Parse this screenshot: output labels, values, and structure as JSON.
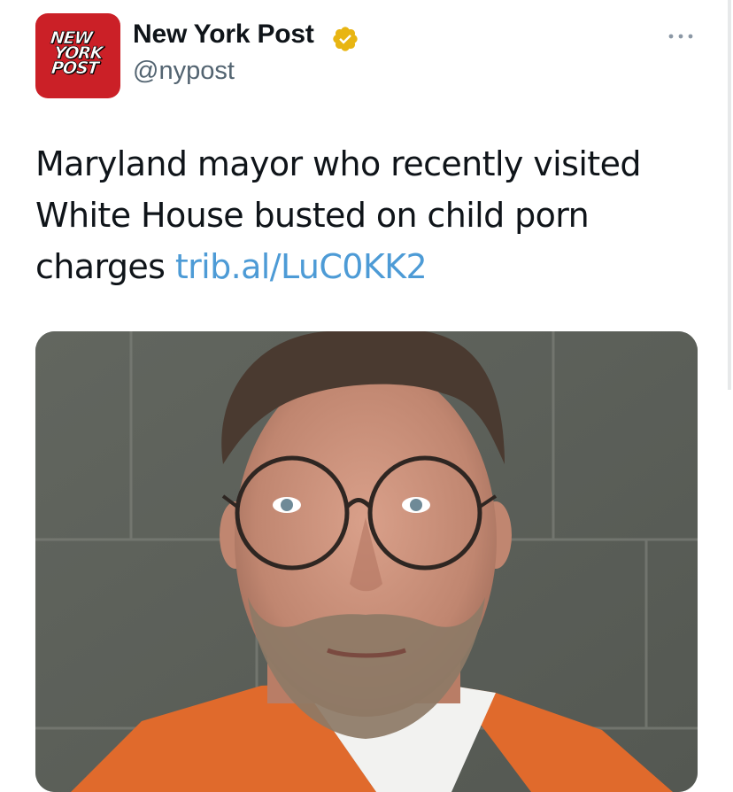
{
  "account": {
    "display_name": "New York Post",
    "handle": "@nypost",
    "verified": true,
    "verified_color": "#e8b512",
    "avatar": {
      "logo_lines": [
        "NEW",
        "YORK",
        "POST"
      ],
      "background": "#cb2027"
    }
  },
  "menu": {
    "icon": "more-horizontal-icon"
  },
  "tweet": {
    "text": "Maryland mayor who recently visited White House busted on child porn charges",
    "link": "trib.al/LuC0KK2",
    "link_color": "#4d9bd6"
  },
  "media": {
    "type": "photo"
  }
}
